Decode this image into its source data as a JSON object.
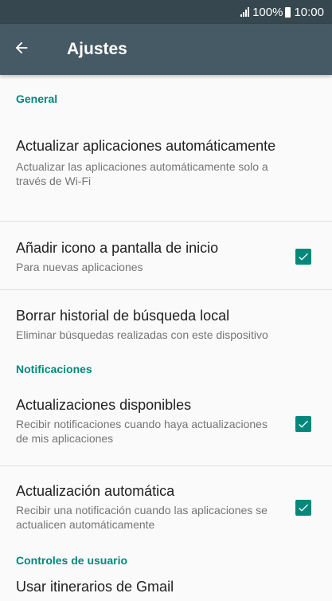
{
  "status_bar": {
    "battery": "100%",
    "time": "10:00"
  },
  "app_bar": {
    "title": "Ajustes",
    "back_icon": "arrow-left-icon"
  },
  "sections": {
    "general": {
      "header": "General",
      "items": [
        {
          "title": "Actualizar aplicaciones automáticamente",
          "subtitle": "Actualizar las aplicaciones automáticamente solo a través de Wi-Fi"
        },
        {
          "title": "Añadir icono a pantalla de inicio",
          "subtitle": "Para nuevas aplicaciones",
          "checked": true
        },
        {
          "title": "Borrar historial de búsqueda local",
          "subtitle": "Eliminar búsquedas realizadas con este dispositivo"
        }
      ]
    },
    "notifications": {
      "header": "Notificaciones",
      "items": [
        {
          "title": "Actualizaciones disponibles",
          "subtitle": "Recibir notificaciones cuando haya actualizaciones de mis aplicaciones",
          "checked": true
        },
        {
          "title": "Actualización automática",
          "subtitle": "Recibir una notificación cuando las aplicaciones se actualicen automáticamente",
          "checked": true
        }
      ]
    },
    "user_controls": {
      "header": "Controles de usuario",
      "items": [
        {
          "title": "Usar itinerarios de Gmail"
        }
      ]
    }
  },
  "colors": {
    "accent": "#00897b",
    "app_bar": "#455a64",
    "status_bar": "#37474f"
  }
}
